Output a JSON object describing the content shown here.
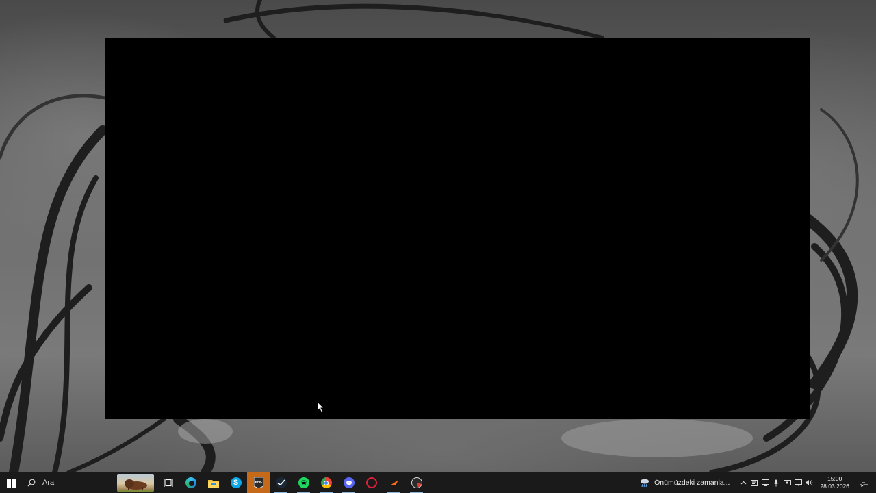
{
  "taskbar": {
    "search_placeholder": "Ara",
    "apps": [
      {
        "name": "Task View",
        "icon": "task-view-icon"
      },
      {
        "name": "Microsoft Edge",
        "icon": "edge-icon"
      },
      {
        "name": "File Explorer",
        "icon": "folder-icon"
      },
      {
        "name": "Skype",
        "icon": "skype-icon"
      },
      {
        "name": "Epic Games Launcher",
        "icon": "epic-games-icon",
        "active": true
      },
      {
        "name": "Steam",
        "icon": "steam-icon"
      },
      {
        "name": "Spotify",
        "icon": "spotify-icon"
      },
      {
        "name": "Google Chrome",
        "icon": "chrome-icon"
      },
      {
        "name": "Discord",
        "icon": "discord-icon"
      },
      {
        "name": "Opera GX",
        "icon": "opera-gx-icon"
      },
      {
        "name": "App",
        "icon": "arrow-app-icon"
      },
      {
        "name": "Recorder",
        "icon": "record-app-icon"
      }
    ],
    "weather_text": "Önümüzdeki zamanla...",
    "clock": {
      "time": "15:00",
      "date": "28.03.2026"
    }
  },
  "colors": {
    "taskbar_bg": "#1a1a1a",
    "active_app_bg": "#c66a1a",
    "window_bg": "#000000"
  }
}
